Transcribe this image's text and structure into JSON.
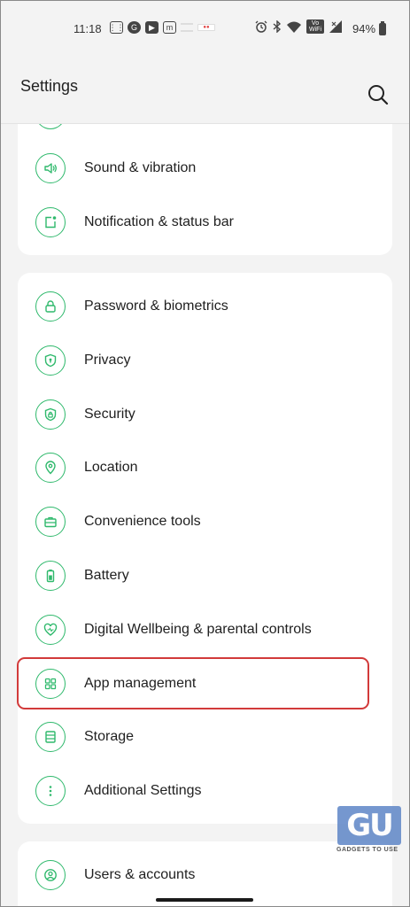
{
  "status_bar": {
    "time": "11:18",
    "left_icons": [
      "keypad-icon",
      "google-icon",
      "youtube-icon",
      "m-icon",
      "wind-icon",
      "caller-icon"
    ],
    "right_icons": [
      "alarm-icon",
      "bluetooth-icon",
      "wifi-icon",
      "vowifi-icon",
      "signal-icon"
    ],
    "vowifi_text": "Vo WiFi",
    "battery": "94%"
  },
  "header": {
    "title": "Settings",
    "search_icon": "search-icon"
  },
  "card1": {
    "items": [
      {
        "label": "Sound & vibration",
        "icon": "speaker-icon"
      },
      {
        "label": "Notification & status bar",
        "icon": "notification-icon"
      }
    ]
  },
  "card2": {
    "items": [
      {
        "label": "Password & biometrics",
        "icon": "lock-icon"
      },
      {
        "label": "Privacy",
        "icon": "privacy-shield-icon"
      },
      {
        "label": "Security",
        "icon": "security-shield-icon"
      },
      {
        "label": "Location",
        "icon": "location-pin-icon"
      },
      {
        "label": "Convenience tools",
        "icon": "toolbox-icon"
      },
      {
        "label": "Battery",
        "icon": "battery-icon"
      },
      {
        "label": "Digital Wellbeing & parental controls",
        "icon": "heart-icon"
      },
      {
        "label": "App management",
        "icon": "app-grid-icon"
      },
      {
        "label": "Storage",
        "icon": "storage-icon"
      },
      {
        "label": "Additional Settings",
        "icon": "more-dots-icon"
      }
    ]
  },
  "card3": {
    "items": [
      {
        "label": "Users & accounts",
        "icon": "user-icon"
      }
    ]
  },
  "watermark": {
    "letters": "GU",
    "text": "GADGETS TO USE"
  },
  "colors": {
    "accent": "#2fb96c",
    "highlight": "#d23a3a",
    "background": "#f3f3f3",
    "card": "#ffffff"
  }
}
